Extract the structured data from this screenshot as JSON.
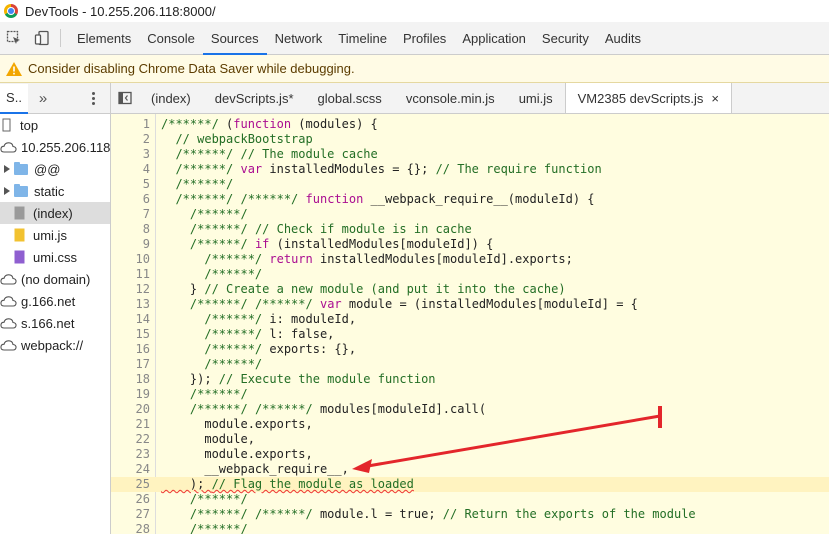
{
  "window": {
    "title": "DevTools - 10.255.206.118:8000/"
  },
  "main_tabs": [
    "Elements",
    "Console",
    "Sources",
    "Network",
    "Timeline",
    "Profiles",
    "Application",
    "Security",
    "Audits"
  ],
  "active_main_tab": "Sources",
  "warning": {
    "text": "Consider disabling Chrome Data Saver while debugging."
  },
  "navigator": {
    "tab_label": "S..",
    "more": "»",
    "tree": [
      {
        "label": "top",
        "icon": "frame-icon",
        "indent": 0
      },
      {
        "label": "10.255.206.118",
        "icon": "cloud-icon",
        "indent": 0
      },
      {
        "label": "@@",
        "icon": "folder-icon",
        "indent": 1,
        "expandable": true
      },
      {
        "label": "static",
        "icon": "folder-icon",
        "indent": 1,
        "expandable": true
      },
      {
        "label": "(index)",
        "icon": "document-file-icon",
        "indent": 1,
        "selected": true
      },
      {
        "label": "umi.js",
        "icon": "js-file-icon",
        "indent": 1
      },
      {
        "label": "umi.css",
        "icon": "css-file-icon",
        "indent": 1
      },
      {
        "label": "(no domain)",
        "icon": "cloud-icon",
        "indent": 0
      },
      {
        "label": "g.166.net",
        "icon": "cloud-icon",
        "indent": 0
      },
      {
        "label": "s.166.net",
        "icon": "cloud-icon",
        "indent": 0
      },
      {
        "label": "webpack://",
        "icon": "cloud-icon",
        "indent": 0
      }
    ]
  },
  "file_tabs": [
    {
      "label": "(index)",
      "active": false
    },
    {
      "label": "devScripts.js*",
      "active": false
    },
    {
      "label": "global.scss",
      "active": false
    },
    {
      "label": "vconsole.min.js",
      "active": false
    },
    {
      "label": "umi.js",
      "active": false
    },
    {
      "label": "VM2385 devScripts.js",
      "active": true,
      "closable": true
    }
  ],
  "close_glyph": "×",
  "code_lines": [
    "/******/ (function (modules) {",
    "  // webpackBootstrap",
    "  /******/ // The module cache",
    "  /******/ var installedModules = {}; // The require function",
    "  /******/",
    "  /******/ /******/ function __webpack_require__(moduleId) {",
    "    /******/",
    "    /******/ // Check if module is in cache",
    "    /******/ if (installedModules[moduleId]) {",
    "      /******/ return installedModules[moduleId].exports;",
    "      /******/",
    "    } // Create a new module (and put it into the cache)",
    "    /******/ /******/ var module = (installedModules[moduleId] = {",
    "      /******/ i: moduleId,",
    "      /******/ l: false,",
    "      /******/ exports: {},",
    "      /******/",
    "    }); // Execute the module function",
    "    /******/",
    "    /******/ /******/ modules[moduleId].call(",
    "      module.exports,",
    "      module,",
    "      module.exports,",
    "      __webpack_require__,",
    "    ); // Flag the module as loaded",
    "    /******/",
    "    /******/ /******/ module.l = true; // Return the exports of the module",
    "    /******/"
  ],
  "colors": {
    "accent": "#1a73e8",
    "annotation_arrow": "#e3262b",
    "editor_bg": "#fffde0"
  }
}
